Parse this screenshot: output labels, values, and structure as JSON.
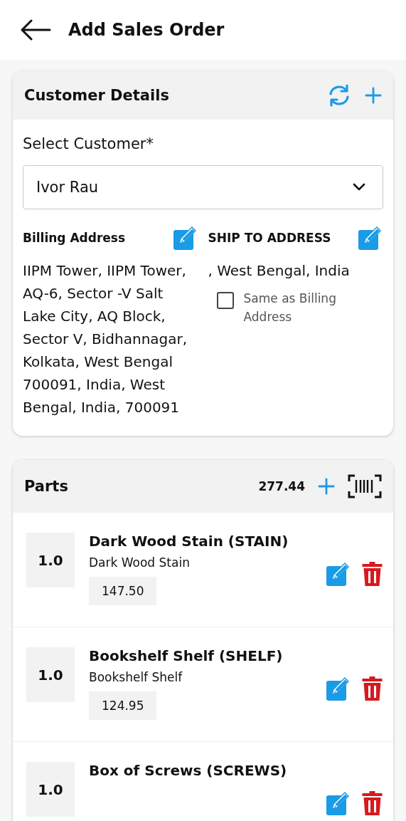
{
  "header": {
    "title": "Add Sales Order"
  },
  "customer_details": {
    "title": "Customer Details",
    "select_label": "Select Customer*",
    "customer": "Ivor Rau",
    "billing": {
      "title": "Billing Address",
      "address": "IIPM Tower, IIPM Tower, AQ-6, Sector -V Salt Lake City, AQ Block, Sector V, Bidhannagar, Kolkata, West Bengal 700091, India, West Bengal, India, 700091"
    },
    "shipping": {
      "title": "SHIP TO ADDRESS",
      "address": ", West Bengal, India",
      "same_as_billing": {
        "label": "Same as Billing Address",
        "checked": false
      }
    }
  },
  "parts": {
    "title": "Parts",
    "total": "277.44",
    "items": [
      {
        "quantity": "1.0",
        "name": "Dark Wood Stain (STAIN)",
        "description": "Dark Wood Stain",
        "price": "147.50"
      },
      {
        "quantity": "1.0",
        "name": "Bookshelf Shelf (SHELF)",
        "description": "Bookshelf Shelf",
        "price": "124.95"
      },
      {
        "quantity": "1.0",
        "name": "Box of Screws (SCREWS)"
      }
    ]
  }
}
